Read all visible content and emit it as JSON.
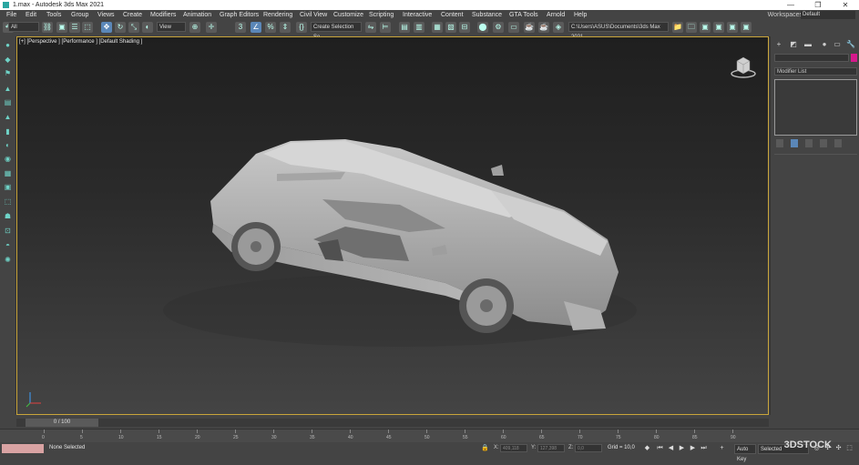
{
  "window": {
    "title": "1.max - Autodesk 3ds Max 2021",
    "min": "—",
    "max": "❐",
    "close": "✕"
  },
  "menu": {
    "items": [
      "File",
      "Edit",
      "Tools",
      "Group",
      "Views",
      "Create",
      "Modifiers",
      "Animation",
      "Graph Editors",
      "Rendering",
      "Civil View",
      "Customize",
      "Scripting",
      "Interactive",
      "Content",
      "Substance",
      "GTA Tools",
      "Arnold",
      "Help"
    ],
    "workspaces_label": "Workspaces:",
    "workspaces_value": "Default"
  },
  "toolbar": {
    "filter_value": "All",
    "view_value": "View",
    "selection_set_placeholder": "Create Selection Se",
    "path_value": "C:\\Users\\ASUS\\Documents\\3ds Max 2021"
  },
  "viewport": {
    "label": "[+] [Perspective ] [Performance ] [Default Shading ]"
  },
  "command_panel": {
    "modifier_list": "Modifier List"
  },
  "timeslider": {
    "value": "0 / 100"
  },
  "timeline": {
    "ticks": [
      "0",
      "5",
      "10",
      "15",
      "20",
      "25",
      "30",
      "35",
      "40",
      "45",
      "50",
      "55",
      "60",
      "65",
      "70",
      "75",
      "80",
      "85",
      "90"
    ]
  },
  "status": {
    "selection": "None Selected",
    "x_label": "X:",
    "x_value": "409,118",
    "y_label": "Y:",
    "y_value": "127,398",
    "z_label": "Z:",
    "z_value": "0,0",
    "grid": "Grid = 10,0",
    "autokey": "Auto Key",
    "selected": "Selected"
  },
  "watermark": "3DSTOCK"
}
